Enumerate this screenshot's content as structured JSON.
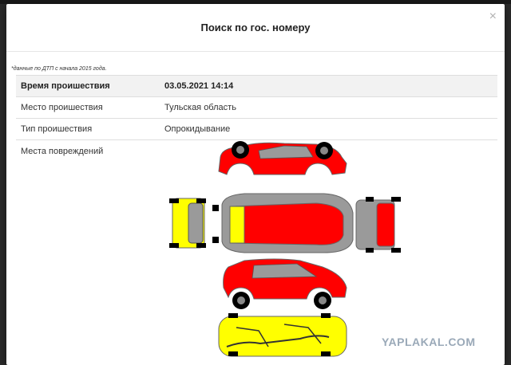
{
  "dialog": {
    "title": "Поиск по гос. номеру",
    "close_symbol": "×",
    "note": "*данные по ДТП с начала 2015 года.",
    "rows": [
      {
        "label": "Время проишествия",
        "value": "03.05.2021 14:14"
      },
      {
        "label": "Место проишествия",
        "value": "Тульская область"
      },
      {
        "label": "Тип проишествия",
        "value": "Опрокидывание"
      }
    ],
    "damage_label": "Места повреждений"
  },
  "diagram": {
    "damaged_color": "#ff0000",
    "underside_color": "#ffff00",
    "glass_color": "#9a9a9a",
    "tire_color": "#000000",
    "zones": {
      "left_side": "damaged",
      "front": "damaged",
      "roof": "damaged",
      "rear": "damaged",
      "right_side": "damaged",
      "bottom": "damaged"
    }
  },
  "watermark": "YAPLAKAL.COM",
  "colors": {
    "backdrop": "#2b2b2b",
    "header_row": "#f2f2f2",
    "border": "#dedede"
  }
}
